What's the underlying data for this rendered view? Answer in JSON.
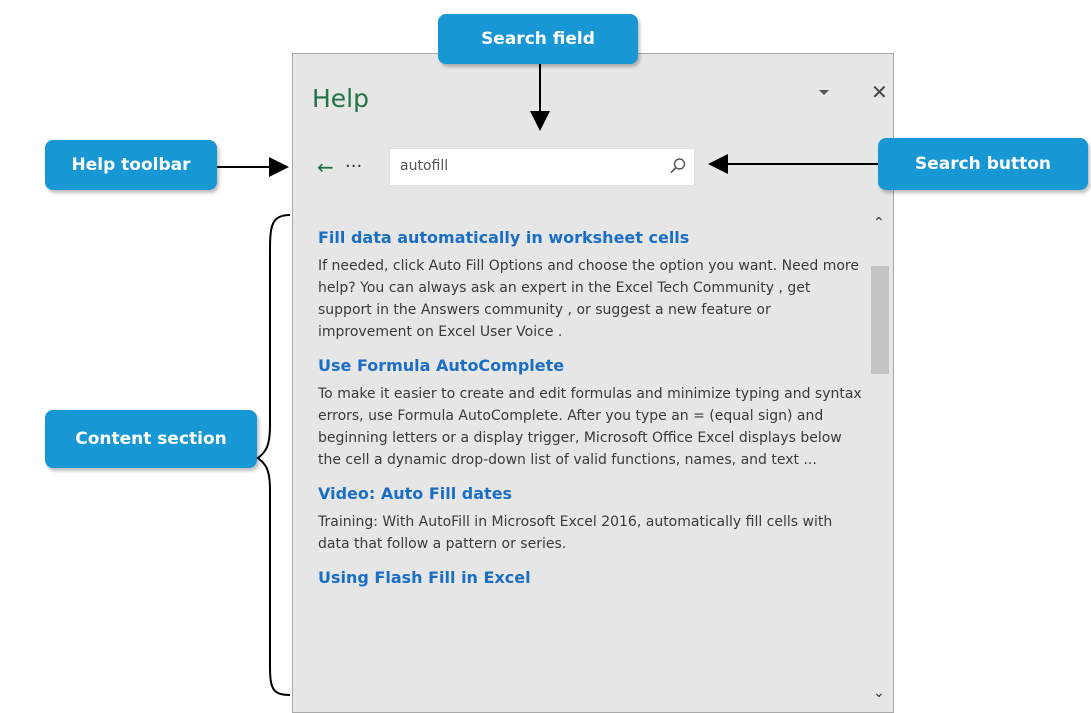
{
  "pane": {
    "title": "Help",
    "search": {
      "value": "autofill"
    },
    "results": [
      {
        "title": "Fill data automatically in worksheet cells",
        "description": "If needed, click Auto Fill Options and choose the option you want. Need more help? You can always ask an expert in the Excel Tech Community , get support in the Answers community , or suggest a new feature or improvement on Excel User Voice ."
      },
      {
        "title": "Use Formula AutoComplete",
        "description": "To make it easier to create and edit formulas and minimize typing and syntax errors, use Formula AutoComplete. After you type an = (equal sign) and beginning letters or a display trigger, Microsoft Office Excel displays below the cell a dynamic drop-down list of valid functions, names, and text ..."
      },
      {
        "title": "Video: Auto Fill dates",
        "description": "Training: With AutoFill in Microsoft Excel 2016, automatically fill cells with data that follow a pattern or series."
      },
      {
        "title": "Using Flash Fill in Excel",
        "description": ""
      }
    ],
    "icons": {
      "back": "back-arrow-icon",
      "more": "more-options-icon",
      "search": "search-icon",
      "dropdown": "dropdown-icon",
      "close": "close-icon"
    }
  },
  "callouts": {
    "search_field": "Search field",
    "help_toolbar": "Help toolbar",
    "search_button": "Search button",
    "content_section": "Content section"
  },
  "colors": {
    "accent": "#217346",
    "link": "#1a6fc4",
    "callout": "#1797d4",
    "pane_bg": "#e6e6e6"
  }
}
